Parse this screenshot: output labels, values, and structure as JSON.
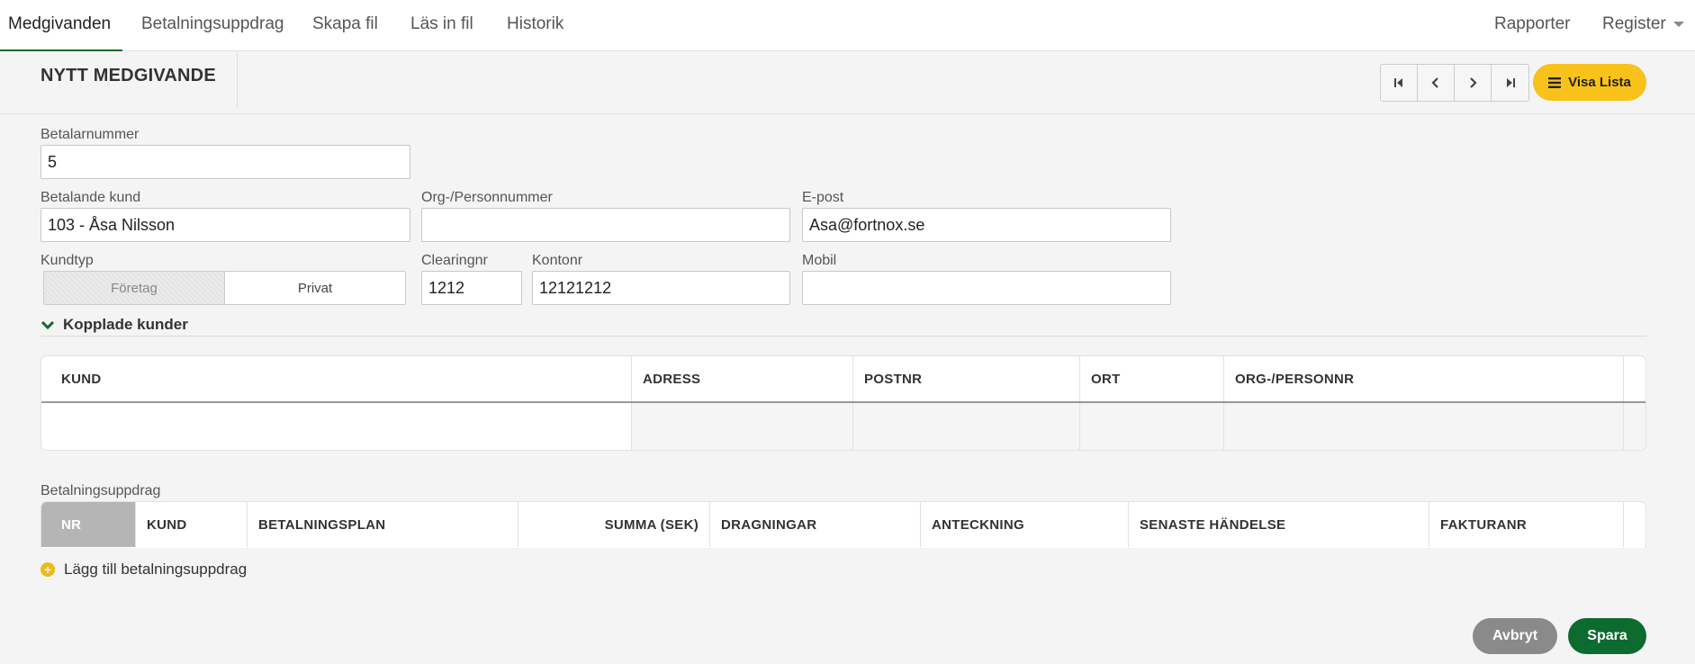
{
  "topnav": {
    "tabs": [
      {
        "label": "Medgivanden",
        "active": true
      },
      {
        "label": "Betalningsuppdrag"
      },
      {
        "label": "Skapa fil"
      },
      {
        "label": "Läs in fil"
      },
      {
        "label": "Historik"
      }
    ],
    "right": [
      {
        "label": "Rapporter"
      },
      {
        "label": "Register"
      }
    ]
  },
  "header": {
    "title": "NYTT MEDGIVANDE",
    "visa_lista": "Visa Lista"
  },
  "form": {
    "betalarnummer": {
      "label": "Betalarnummer",
      "value": "5"
    },
    "betalande_kund": {
      "label": "Betalande kund",
      "value": "103 - Åsa Nilsson"
    },
    "org_personnummer": {
      "label": "Org-/Personnummer",
      "value": ""
    },
    "epost": {
      "label": "E-post",
      "value": "Asa@fortnox.se"
    },
    "kundtyp": {
      "label": "Kundtyp",
      "options": [
        "Företag",
        "Privat"
      ],
      "selected": "Företag"
    },
    "clearingnr": {
      "label": "Clearingnr",
      "value": "1212"
    },
    "kontonr": {
      "label": "Kontonr",
      "value": "12121212"
    },
    "mobil": {
      "label": "Mobil",
      "value": ""
    }
  },
  "kopplade": {
    "title": "Kopplade kunder",
    "columns": [
      "KUND",
      "ADRESS",
      "POSTNR",
      "ORT",
      "ORG-/PERSONNR"
    ]
  },
  "betalningsuppdrag": {
    "label": "Betalningsuppdrag",
    "columns": [
      "NR",
      "KUND",
      "BETALNINGSPLAN",
      "SUMMA (SEK)",
      "DRAGNINGAR",
      "ANTECKNING",
      "SENASTE HÄNDELSE",
      "FAKTURANR"
    ],
    "add_label": "Lägg till betalningsuppdrag"
  },
  "actions": {
    "cancel": "Avbryt",
    "save": "Spara"
  },
  "colors": {
    "accent_green": "#0c6b2e",
    "accent_yellow": "#f8c21a",
    "cancel_gray": "#8a8a8a"
  }
}
